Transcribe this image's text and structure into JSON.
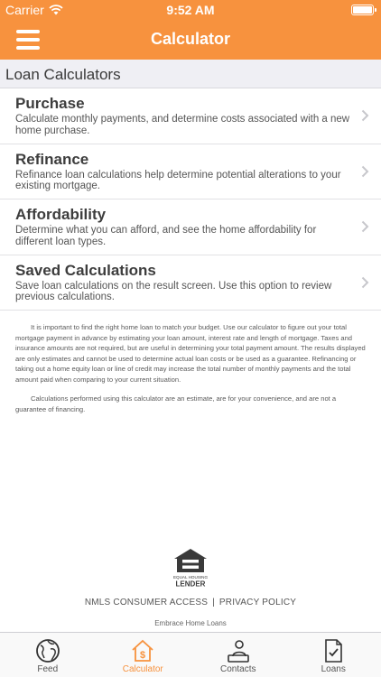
{
  "status": {
    "carrier": "Carrier",
    "time": "9:52 AM"
  },
  "nav": {
    "title": "Calculator"
  },
  "section_header": "Loan Calculators",
  "items": [
    {
      "title": "Purchase",
      "description": "Calculate monthly payments, and determine costs associated with a new home purchase."
    },
    {
      "title": "Refinance",
      "description": "Refinance loan calculations help determine potential alterations to your existing mortgage."
    },
    {
      "title": "Affordability",
      "description": "Determine what you can afford, and see the home affordability for different loan types."
    },
    {
      "title": "Saved Calculations",
      "description": "Save loan calculations on the result screen. Use this option to review previous calculations."
    }
  ],
  "disclaimer": [
    "It is important to find the right home loan to match your budget. Use our calculator to figure out your total mortgage payment in advance by estimating your loan amount, interest rate and length of mortgage. Taxes and insurance amounts are not required, but are useful in determining your total payment amount. The results displayed are only estimates and cannot be used to determine actual loan costs or be used as a guarantee. Refinancing or taking out a home equity loan or line of credit may increase the total number of monthly payments and the total amount paid when comparing to your current situation.",
    "Calculations performed using this calculator are an estimate, are for your convenience, and are not a guarantee of financing."
  ],
  "logo": {
    "icon": "equal-housing-lender-icon",
    "line1": "EQUAL HOUSING",
    "line2": "LENDER"
  },
  "footer": {
    "nmls": "NMLS CONSUMER ACCESS",
    "separator": "|",
    "privacy": "PRIVACY POLICY",
    "company": "Embrace Home Loans"
  },
  "tabs": [
    {
      "label": "Feed",
      "icon": "globe-icon"
    },
    {
      "label": "Calculator",
      "icon": "house-dollar-icon",
      "active": true
    },
    {
      "label": "Contacts",
      "icon": "contacts-icon"
    },
    {
      "label": "Loans",
      "icon": "document-check-icon"
    }
  ],
  "colors": {
    "accent": "#f7923e",
    "text": "#3d3d3d",
    "tab_inactive": "#555555"
  }
}
